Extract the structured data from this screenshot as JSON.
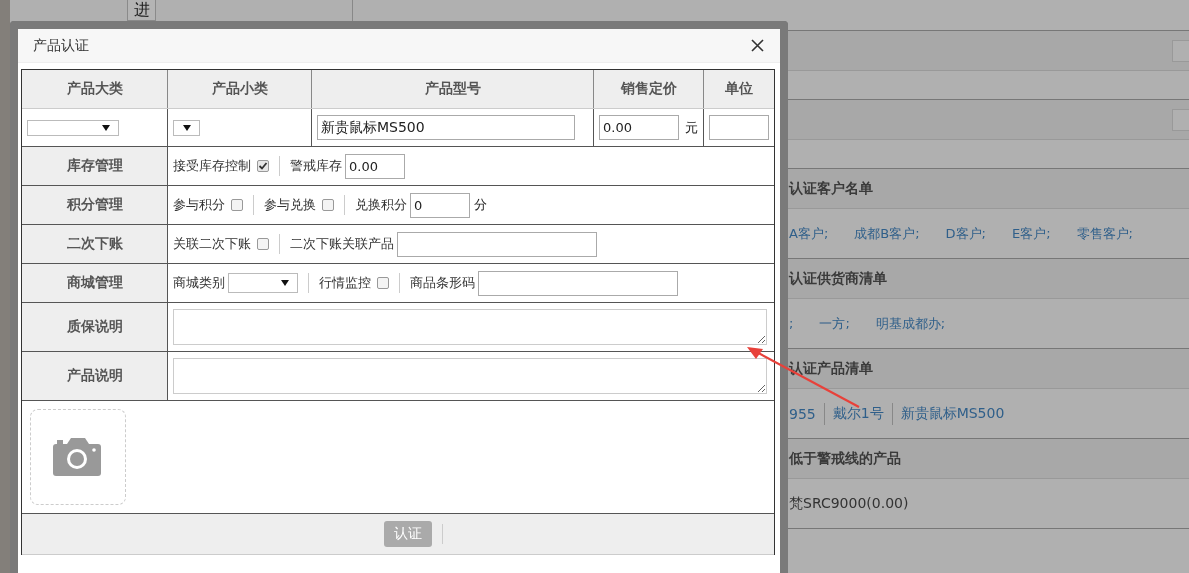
{
  "background": {
    "top_cell": "进",
    "sections": [
      {
        "title": "认证客户名单",
        "kind": "semicolon_links",
        "items": [
          "A客户;",
          "成都B客户;",
          "D客户;",
          "E客户;",
          "零售客户;"
        ]
      },
      {
        "title": "认证供货商清单",
        "kind": "semicolon_links",
        "items": [
          ";",
          "一方;",
          "明基成都办;"
        ]
      },
      {
        "title": "认证产品清单",
        "kind": "bar_links",
        "items": [
          "955",
          "戴尔1号",
          "新贵鼠标MS500"
        ]
      },
      {
        "title": "低于警戒线的产品",
        "kind": "text",
        "items": [
          "梵SRC9000(0.00)"
        ]
      }
    ]
  },
  "dialog": {
    "title": "产品认证",
    "columns": [
      "产品大类",
      "产品小类",
      "产品型号",
      "销售定价",
      "单位"
    ],
    "product": {
      "model": "新贵鼠标MS500",
      "price": "0.00",
      "price_unit": "元"
    },
    "rows": [
      {
        "label": "库存管理",
        "kind": "fields",
        "items": [
          {
            "kind": "checkbox",
            "label": "接受库存控制",
            "checked": true
          },
          {
            "kind": "input",
            "label": "警戒库存",
            "value": "0.00"
          }
        ]
      },
      {
        "label": "积分管理",
        "kind": "fields",
        "items": [
          {
            "kind": "checkbox",
            "label": "参与积分",
            "checked": false
          },
          {
            "kind": "checkbox",
            "label": "参与兑换",
            "checked": false
          },
          {
            "kind": "input",
            "label": "兑换积分",
            "value": "0",
            "suffix": "分"
          }
        ]
      },
      {
        "label": "二次下账",
        "kind": "fields",
        "items": [
          {
            "kind": "checkbox",
            "label": "关联二次下账",
            "checked": false
          },
          {
            "kind": "wide_input",
            "label": "二次下账关联产品",
            "value": ""
          }
        ]
      },
      {
        "label": "商城管理",
        "kind": "fields",
        "items": [
          {
            "kind": "select",
            "label": "商城类别"
          },
          {
            "kind": "checkbox",
            "label": "行情监控",
            "checked": false
          },
          {
            "kind": "wide_input",
            "label": "商品条形码",
            "value": ""
          }
        ]
      },
      {
        "label": "质保说明",
        "kind": "textarea"
      },
      {
        "label": "产品说明",
        "kind": "textarea"
      }
    ],
    "submit_button": "认证"
  }
}
